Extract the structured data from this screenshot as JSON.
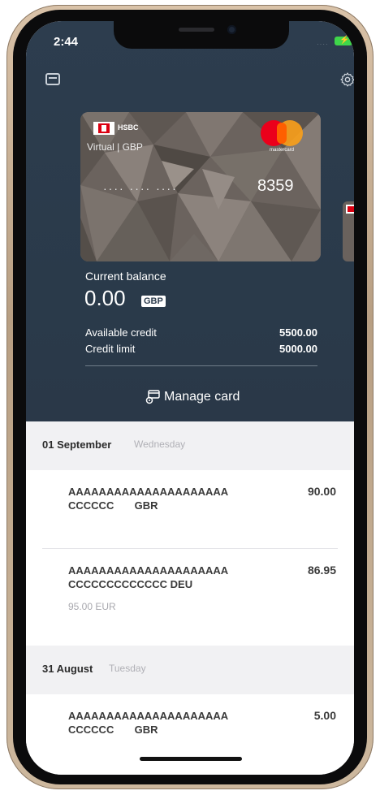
{
  "status_bar": {
    "time": "2:44",
    "signal": "····",
    "battery_color": "#3fd64a"
  },
  "header": {
    "left_icon": "cards-icon",
    "right_icon": "gear-icon",
    "background": "#2d3d4e"
  },
  "card": {
    "brand": "HSBC",
    "subtitle": "Virtual | GBP",
    "masked_groups": "····   ····   ····",
    "last4": "8359",
    "network": "mastercard"
  },
  "balance": {
    "label": "Current balance",
    "amount": "0.00",
    "currency": "GBP"
  },
  "credit": {
    "available_label": "Available credit",
    "available_value": "5500.00",
    "limit_label": "Credit limit",
    "limit_value": "5000.00"
  },
  "manage_card": {
    "label": "Manage card",
    "icon": "manage-card-icon"
  },
  "sections": [
    {
      "date": "01 September",
      "weekday": "Wednesday",
      "transactions": [
        {
          "line1": "AAAAAAAAAAAAAAAAAAAAA",
          "line2": "CCCCCC       GBR",
          "amount": "90.00",
          "foreign": ""
        },
        {
          "line1": "AAAAAAAAAAAAAAAAAAAAA",
          "line2": "CCCCCCCCCCCCC DEU",
          "amount": "86.95",
          "foreign": "95.00 EUR"
        }
      ]
    },
    {
      "date": "31 August",
      "weekday": "Tuesday",
      "transactions": [
        {
          "line1": "AAAAAAAAAAAAAAAAAAAAA",
          "line2": "CCCCCC       GBR",
          "amount": "5.00",
          "foreign": ""
        }
      ]
    }
  ]
}
